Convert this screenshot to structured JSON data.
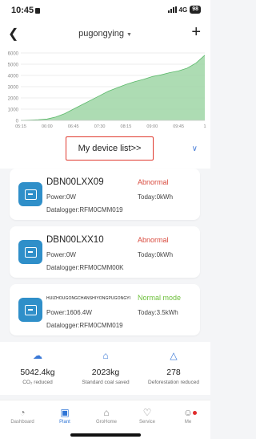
{
  "status_bar": {
    "time": "10:45",
    "network": "4G",
    "battery": "98"
  },
  "header": {
    "title": "pugongying",
    "back_icon": "chevron-left-icon",
    "add_icon": "plus-icon"
  },
  "chart_data": {
    "type": "area",
    "y_ticks": [
      "6000",
      "5000",
      "4000",
      "3000",
      "2000",
      "1000",
      "0"
    ],
    "ylim": [
      0,
      6000
    ],
    "x_ticks": [
      "05:15",
      "06:00",
      "06:45",
      "07:30",
      "08:15",
      "09:00",
      "09:45",
      "1"
    ],
    "x": [
      "05:15",
      "05:30",
      "05:45",
      "06:00",
      "06:15",
      "06:30",
      "06:45",
      "07:00",
      "07:15",
      "07:30",
      "07:45",
      "08:00",
      "08:15",
      "08:30",
      "08:45",
      "09:00",
      "09:15",
      "09:30",
      "09:45",
      "10:00",
      "10:15",
      "10:30"
    ],
    "values": [
      0,
      20,
      60,
      120,
      300,
      600,
      1000,
      1400,
      1800,
      2200,
      2600,
      2900,
      3200,
      3450,
      3650,
      3900,
      4050,
      4250,
      4400,
      4650,
      5100,
      5800
    ],
    "fill_color": "#9fd6a6",
    "line_color": "#5bb96a",
    "grid": true
  },
  "device_list": {
    "label": "My device list>>"
  },
  "devices": [
    {
      "name": "DBN00LXX09",
      "status": "Abnormal",
      "status_type": "abnormal",
      "power": "Power:0W",
      "today": "Today:0kWh",
      "datalogger": "Datalogger:RFM0CMM019"
    },
    {
      "name": "DBN00LXX10",
      "status": "Abnormal",
      "status_type": "abnormal",
      "power": "Power:0W",
      "today": "Today:0kWh",
      "datalogger": "Datalogger:RFM0CMM00K"
    },
    {
      "name": "HUIZHOUGONGCHANSHIYONGPUGONGYI",
      "status": "Normal mode",
      "status_type": "normal",
      "power": "Power:1606.4W",
      "today": "Today:3.5kWh",
      "datalogger": "Datalogger:RFM0CMM019"
    }
  ],
  "stats": [
    {
      "icon": "co2-cloud-icon",
      "value": "5042.4kg",
      "label": "CO₂ reduced"
    },
    {
      "icon": "coal-cart-icon",
      "value": "2023kg",
      "label": "Standard coal saved"
    },
    {
      "icon": "tree-icon",
      "value": "278",
      "label": "Deforestation reduced"
    }
  ],
  "tabs": [
    {
      "label": "Dashboard",
      "icon": "dashboard-icon"
    },
    {
      "label": "Plant",
      "icon": "plant-icon",
      "active": true
    },
    {
      "label": "GroHome",
      "icon": "home-icon"
    },
    {
      "label": "Service",
      "icon": "service-icon"
    },
    {
      "label": "Me",
      "icon": "user-icon"
    }
  ]
}
